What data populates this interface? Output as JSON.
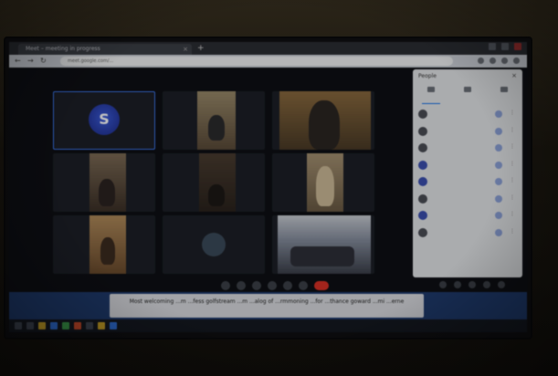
{
  "browser": {
    "tab_title": "Meet – meeting in progress",
    "url": "meet.google.com/...",
    "tab_close": "×",
    "new_tab": "+"
  },
  "tiles": [
    {
      "name": "",
      "kind": "avatar",
      "initial": "S"
    },
    {
      "name": "",
      "kind": "video"
    },
    {
      "name": "",
      "kind": "video"
    },
    {
      "name": "",
      "kind": "video"
    },
    {
      "name": "",
      "kind": "video"
    },
    {
      "name": "",
      "kind": "video"
    },
    {
      "name": "",
      "kind": "video"
    },
    {
      "name": "",
      "kind": "avatar-small"
    },
    {
      "name": "",
      "kind": "video"
    }
  ],
  "panel": {
    "title": "People",
    "tabs": [
      "",
      "",
      ""
    ],
    "participants": [
      "",
      "",
      "",
      "",
      "",
      "",
      "",
      ""
    ]
  },
  "controls": {
    "meeting_info": ""
  },
  "caption": {
    "text": "Most welcoming ...m ...fess golfstream ...m ...alog of ...rmmoning ...for ...thance goward ...mi ...erne"
  },
  "taskbar": {
    "tray_text": ""
  },
  "colors": {
    "accent": "#1a73e8",
    "end_call": "#d93025",
    "caption_band": "#1f3a6d"
  }
}
